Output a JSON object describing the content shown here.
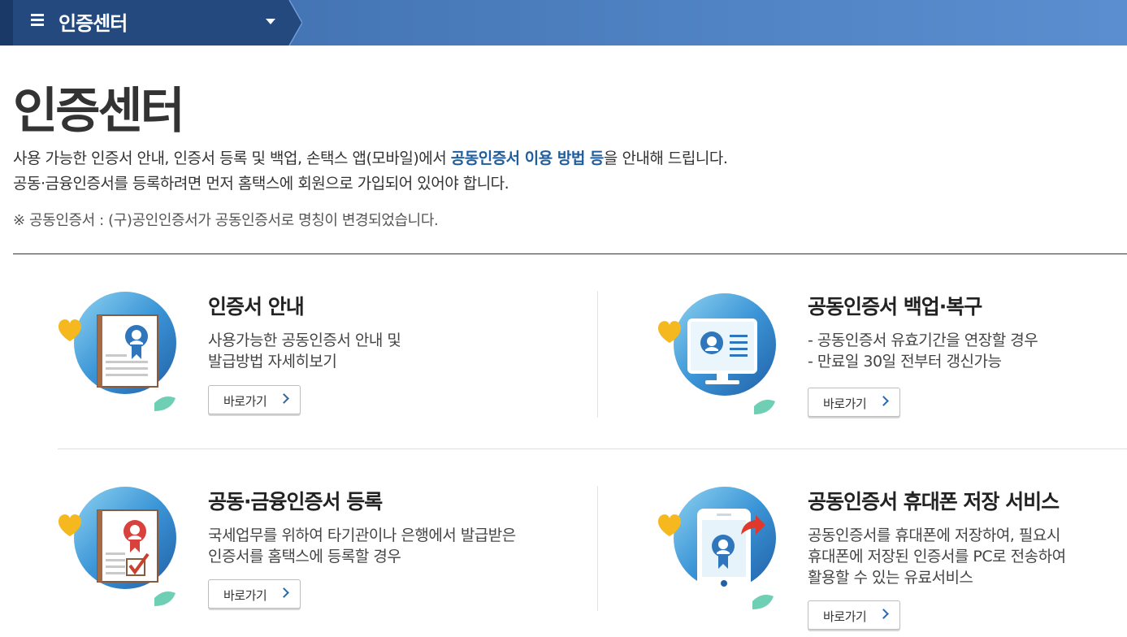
{
  "header": {
    "menu_title": "인증센터",
    "menu_icon": "hamburger-icon",
    "dropdown_icon": "caret-down-icon"
  },
  "page": {
    "title": "인증센터",
    "intro_line1_before": "사용 가능한 인증서 안내, 인증서 등록 및 백업, 손택스 앱(모바일)에서 ",
    "intro_line1_highlight": "공동인증서 이용 방법 등",
    "intro_line1_after": "을 안내해 드립니다.",
    "intro_line2": "공동·금융인증서를 등록하려면 먼저 홈택스에 회원으로 가입되어 있어야 합니다.",
    "note": "※ 공동인증서 : (구)공인인증서가 공동인증서로 명칭이 변경되었습니다."
  },
  "colors": {
    "nav_dark": "#1d3f6e",
    "nav_light": "#4f82c2",
    "highlight": "#1f5d9c",
    "icon_circle": "#3d8fd0"
  },
  "cards": [
    {
      "title": "인증서 안내",
      "desc": [
        "사용가능한 공동인증서 안내 및",
        "발급방법 자세히보기"
      ],
      "button": "바로가기",
      "icon": "certificate-document-icon"
    },
    {
      "title": "공동인증서 백업·복구",
      "desc": [
        "- 공동인증서 유효기간을 연장할 경우",
        "- 만료일 30일 전부터 갱신가능"
      ],
      "button": "바로가기",
      "icon": "monitor-certificate-icon"
    },
    {
      "title": "공동·금융인증서 등록",
      "desc": [
        "국세업무를 위하여 타기관이나 은행에서 발급받은",
        "인증서를 홈택스에 등록할 경우"
      ],
      "button": "바로가기",
      "icon": "certificate-check-icon"
    },
    {
      "title": "공동인증서 휴대폰 저장 서비스",
      "desc": [
        "공동인증서를 휴대폰에 저장하여, 필요시",
        "휴대폰에 저장된 인증서를 PC로 전송하여",
        "활용할 수 있는 유료서비스"
      ],
      "button": "바로가기",
      "icon": "mobile-certificate-icon"
    }
  ]
}
